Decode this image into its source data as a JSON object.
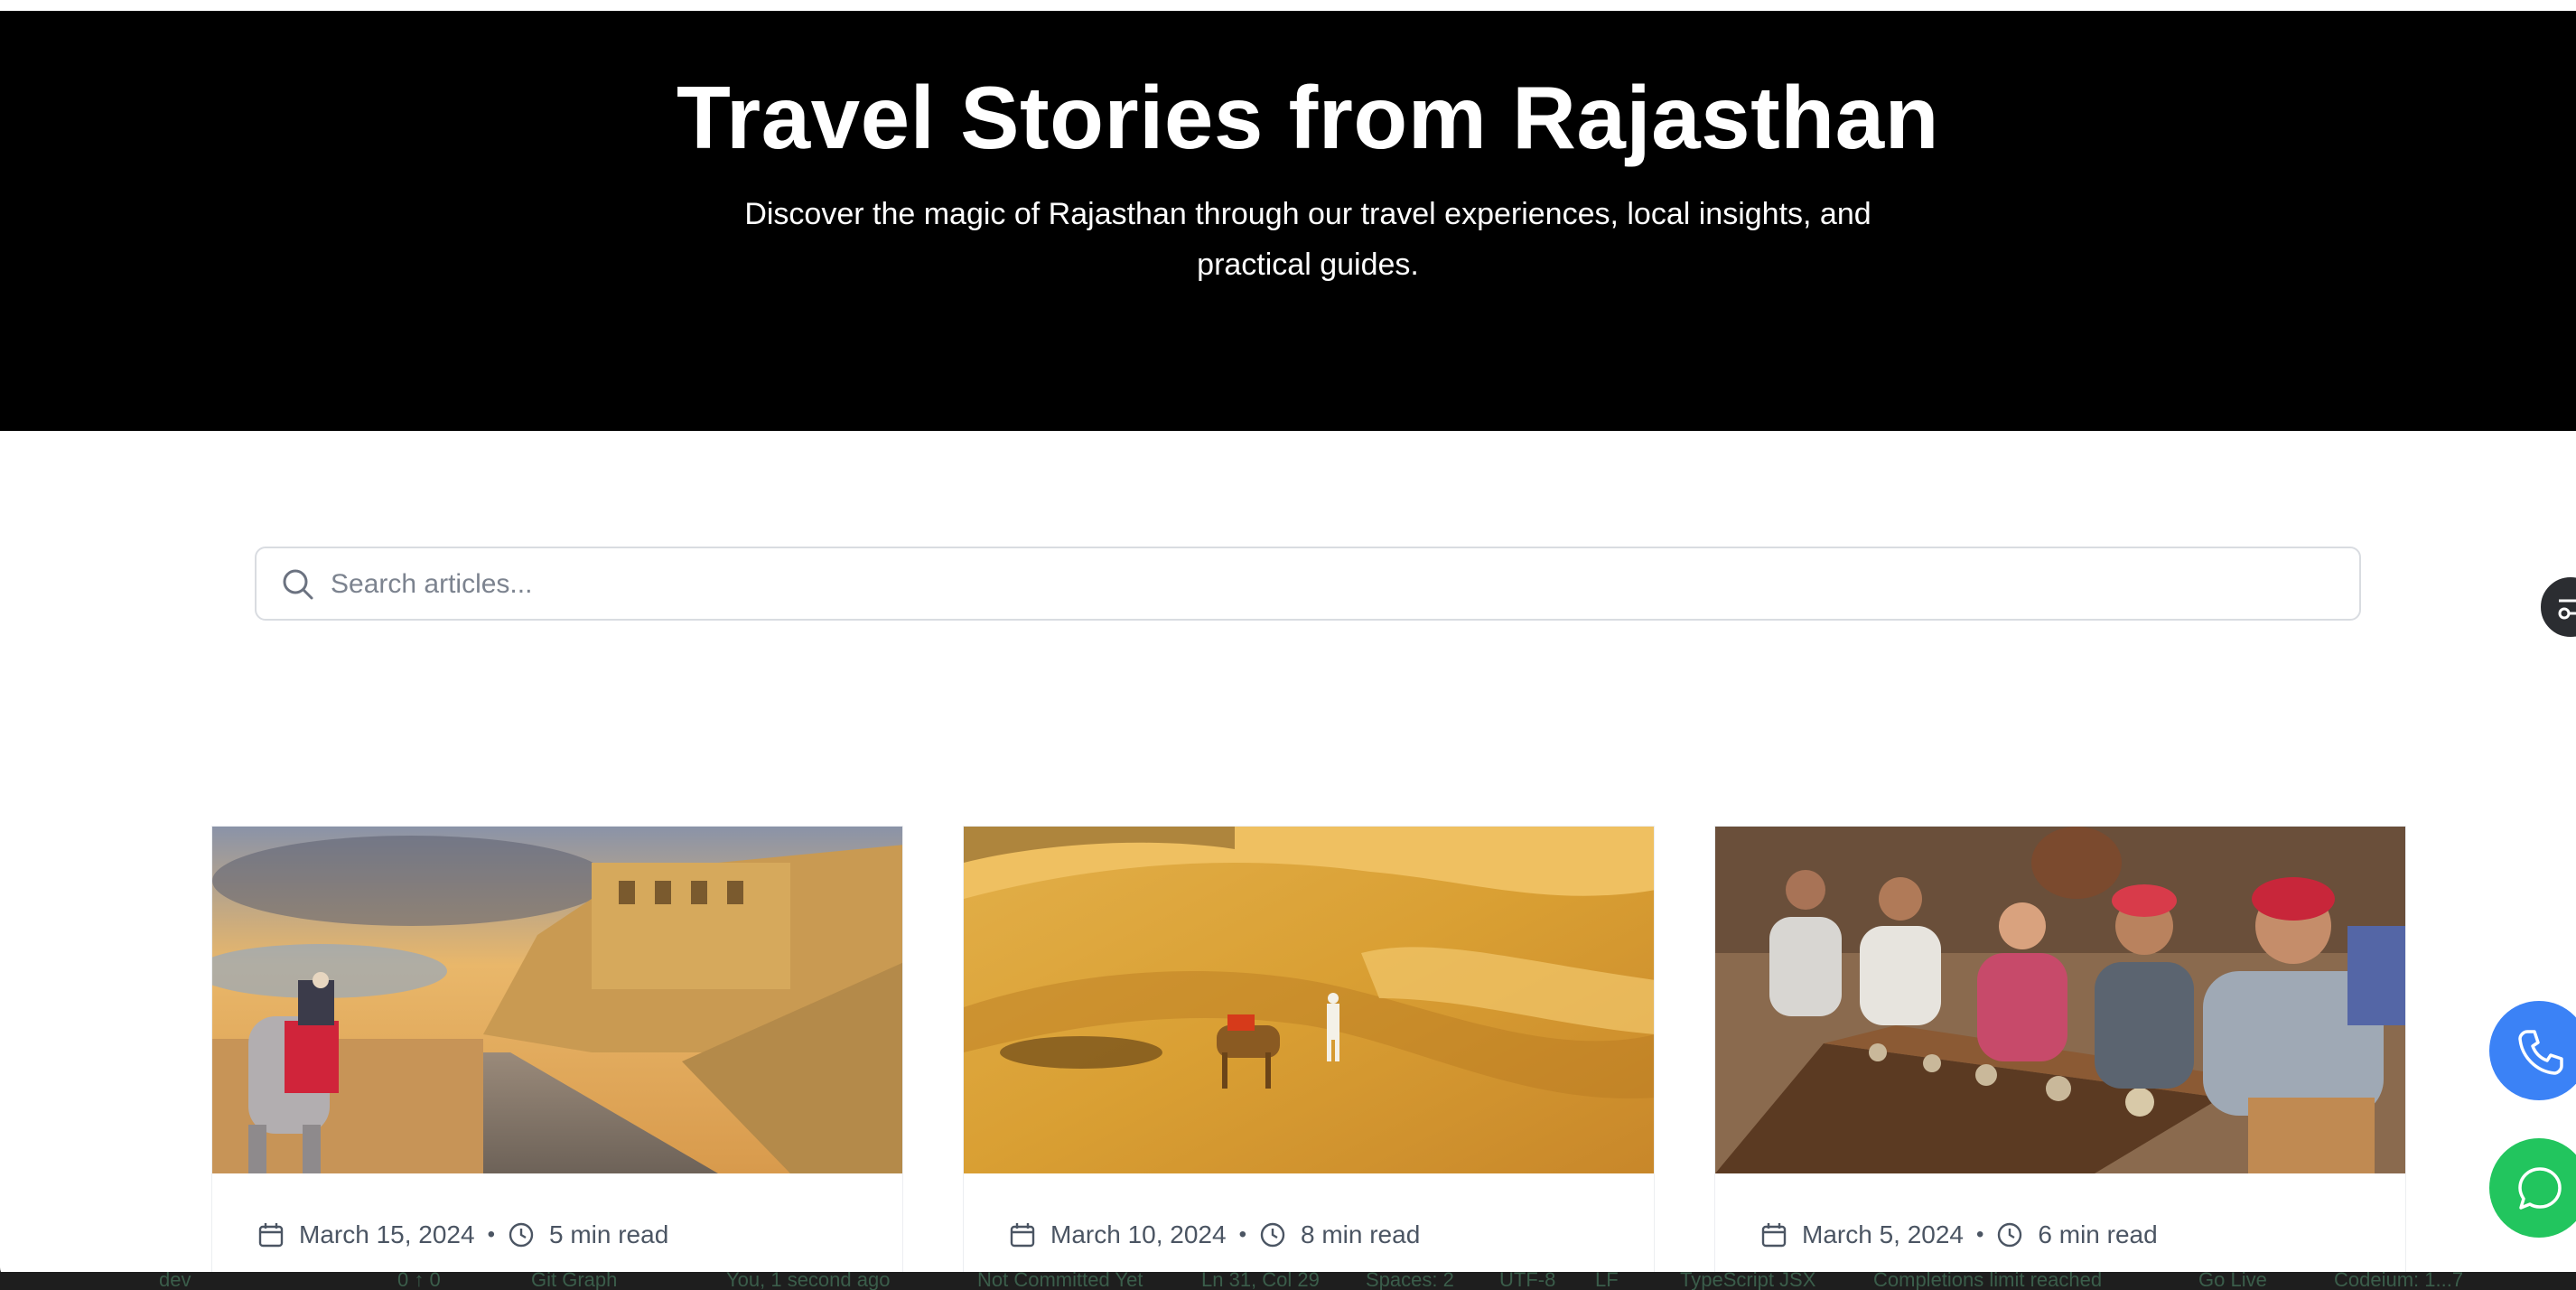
{
  "hero": {
    "title": "Travel Stories from Rajasthan",
    "subtitle_line1": "Discover the magic of Rajasthan through our travel experiences, local insights, and",
    "subtitle_line2": "practical guides."
  },
  "search": {
    "placeholder": "Search articles...",
    "value": ""
  },
  "cards": [
    {
      "date": "March 15, 2024",
      "read_time": "5 min read",
      "image": "fort-elephant-photo"
    },
    {
      "date": "March 10, 2024",
      "read_time": "8 min read",
      "image": "desert-camel-photo"
    },
    {
      "date": "March 5, 2024",
      "read_time": "6 min read",
      "image": "traditional-dining-photo"
    }
  ],
  "separator": "•",
  "floating_buttons": [
    {
      "name": "phone",
      "icon": "phone-icon",
      "color": "#3b82f6"
    },
    {
      "name": "chat",
      "icon": "chat-bubble-icon",
      "color": "#22c55e"
    }
  ],
  "status_bar": {
    "items": [
      "dev",
      "0 ↑ 0",
      "Git Graph",
      "You, 1 second ago",
      "Not Committed Yet",
      "Ln 31, Col 29",
      "Spaces: 2",
      "UTF-8",
      "LF",
      "TypeScript JSX",
      "Completions limit reached",
      "Go Live",
      "Codeium: 1...7"
    ]
  },
  "colors": {
    "hero_bg": "#000000",
    "meta_text": "#4b5563",
    "phone_fab": "#3b82f6",
    "chat_fab": "#22c55e"
  }
}
